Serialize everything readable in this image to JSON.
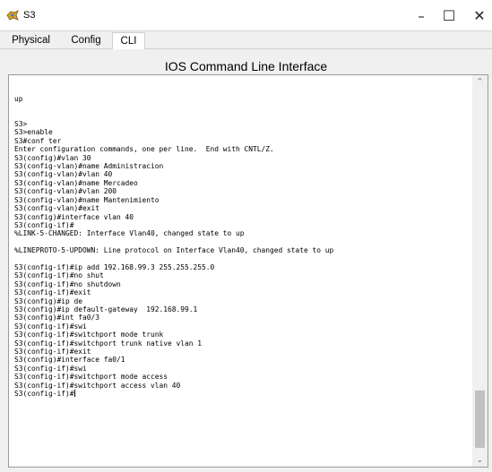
{
  "window": {
    "title": "S3",
    "minimize_glyph": "–",
    "maximize_glyph": "☐",
    "close_glyph": "✕"
  },
  "tabs": [
    {
      "label": "Physical",
      "active": false
    },
    {
      "label": "Config",
      "active": false
    },
    {
      "label": "CLI",
      "active": true
    }
  ],
  "panel": {
    "title": "IOS Command Line Interface"
  },
  "console": {
    "lines": [
      "up",
      "",
      "",
      "S3>",
      "S3>enable",
      "S3#conf ter",
      "Enter configuration commands, one per line.  End with CNTL/Z.",
      "S3(config)#vlan 30",
      "S3(config-vlan)#name Administracion",
      "S3(config-vlan)#vlan 40",
      "S3(config-vlan)#name Mercadeo",
      "S3(config-vlan)#vlan 200",
      "S3(config-vlan)#name Mantenimiento",
      "S3(config-vlan)#exit",
      "S3(config)#interface vlan 40",
      "S3(config-if)#",
      "%LINK-5-CHANGED: Interface Vlan40, changed state to up",
      "",
      "%LINEPROTO-5-UPDOWN: Line protocol on Interface Vlan40, changed state to up",
      "",
      "S3(config-if)#ip add 192.168.99.3 255.255.255.0",
      "S3(config-if)#no shut",
      "S3(config-if)#no shutdown",
      "S3(config-if)#exit",
      "S3(config)#ip de",
      "S3(config)#ip default-gateway  192.168.99.1",
      "S3(config)#int fa0/3",
      "S3(config-if)#swi",
      "S3(config-if)#switchport mode trunk",
      "S3(config-if)#switchport trunk native vlan 1",
      "S3(config-if)#exit",
      "S3(config)#interface fa0/1",
      "S3(config-if)#swi",
      "S3(config-if)#switchport mode access",
      "S3(config-if)#switchport access vlan 40"
    ],
    "prompt": "S3(config-if)#"
  },
  "colors": {
    "panel_bg": "#f0f0f0",
    "console_bg": "#ffffff",
    "text": "#000000"
  },
  "icons": {
    "app": "packet-tracer-switch-icon",
    "scroll_up": "chevron-up-icon",
    "scroll_down": "chevron-down-icon"
  }
}
